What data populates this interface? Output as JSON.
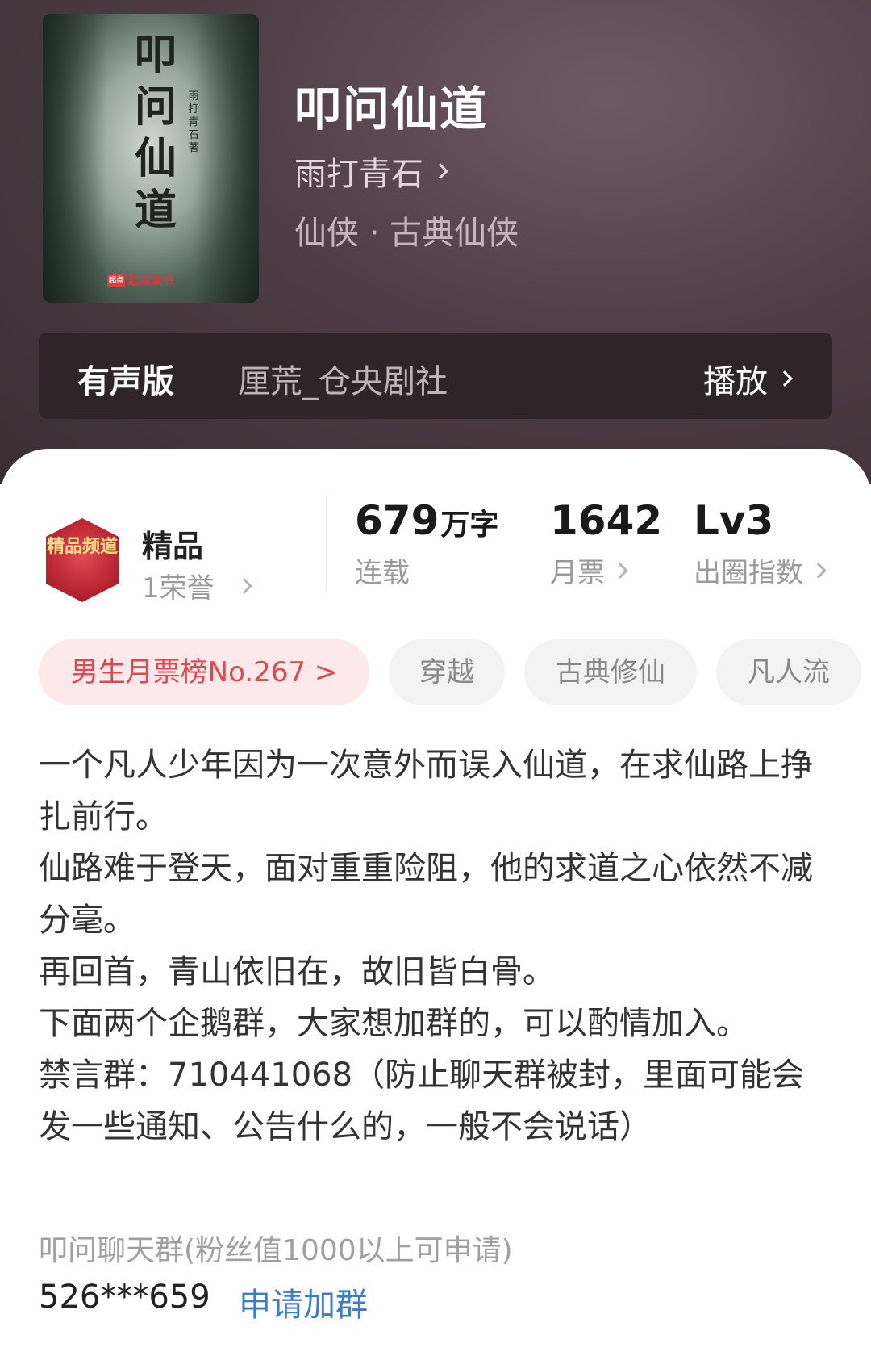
{
  "book": {
    "title": "叩问仙道",
    "author": "雨打青石",
    "genre": "仙侠 · 古典仙侠",
    "cover": {
      "title": "叩问仙道",
      "author": "雨打青石 著",
      "brand": "起点读书",
      "brand_logo": "起点"
    }
  },
  "audio": {
    "label": "有声版",
    "narrator": "厘荒_仓央剧社",
    "play_label": "播放"
  },
  "honor": {
    "badge_text": "精品频道",
    "title": "精品",
    "count": "1荣誉"
  },
  "stats": [
    {
      "value": "679",
      "unit": "万字",
      "label": "连载"
    },
    {
      "value": "1642",
      "unit": "",
      "label": "月票"
    },
    {
      "value": "Lv3",
      "unit": "",
      "label": "出圈指数"
    }
  ],
  "tags": {
    "rank": "男生月票榜No.267 >",
    "items": [
      "穿越",
      "古典修仙",
      "凡人流"
    ]
  },
  "description": [
    "一个凡人少年因为一次意外而误入仙道，在求仙路上挣扎前行。",
    "仙路难于登天，面对重重险阻，他的求道之心依然不减分毫。",
    "再回首，青山依旧在，故旧皆白骨。",
    "下面两个企鹅群，大家想加群的，可以酌情加入。",
    "禁言群：710441068（防止聊天群被封，里面可能会发一些通知、公告什么的，一般不会说话）"
  ],
  "group": {
    "title": "叩问聊天群(粉丝值1000以上可申请)",
    "number": "526***659",
    "join_label": "申请加群"
  },
  "colors": {
    "hero_bg": "#4e3d44",
    "rank_chip_text": "#e6454f",
    "link": "#3d7cc9"
  }
}
